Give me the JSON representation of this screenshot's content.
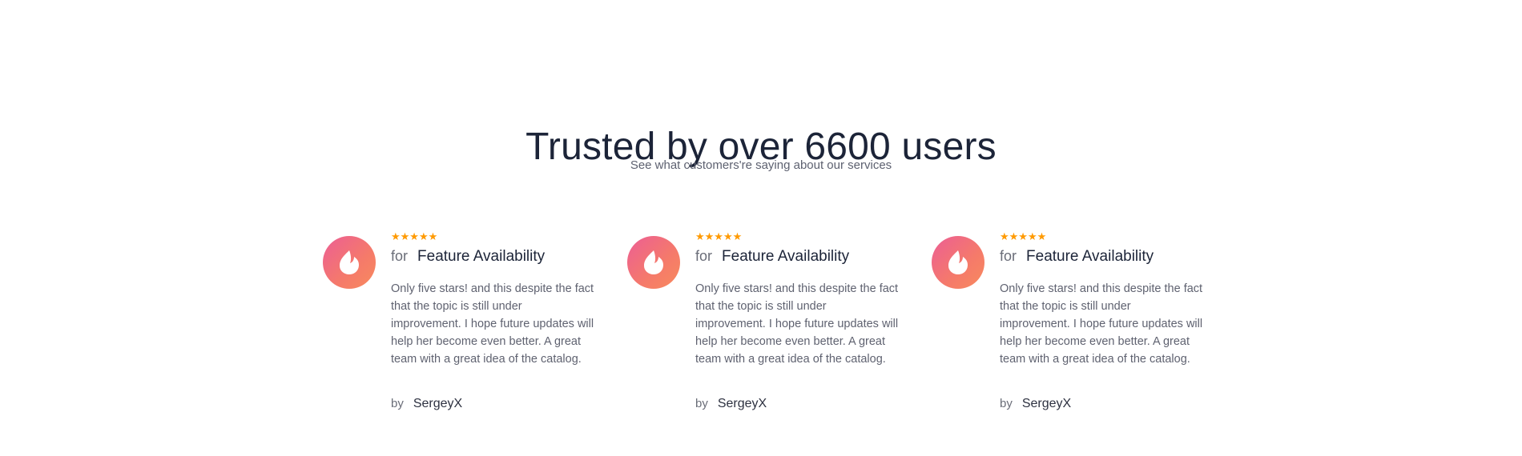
{
  "section": {
    "title": "Trusted by over 6600 users",
    "subtitle": "See what customers're saying about our services"
  },
  "colors": {
    "star": "#ff9a00",
    "avatar_gradient_start": "#ec5e95",
    "avatar_gradient_end": "#f88a5e",
    "heading": "#1c2438"
  },
  "reviews": [
    {
      "rating": 5,
      "stars": "★★★★★",
      "for_label": "for",
      "feature": "Feature Availability",
      "text": "Only five stars! and this despite the fact that the topic is still under improvement. I hope future updates will help her become even better. A great team with a great idea of the catalog.",
      "by_label": "by",
      "author": "SergeyX",
      "avatar_icon": "flame-logo-icon"
    },
    {
      "rating": 5,
      "stars": "★★★★★",
      "for_label": "for",
      "feature": "Feature Availability",
      "text": "Only five stars! and this despite the fact that the topic is still under improvement. I hope future updates will help her become even better. A great team with a great idea of the catalog.",
      "by_label": "by",
      "author": "SergeyX",
      "avatar_icon": "flame-logo-icon"
    },
    {
      "rating": 5,
      "stars": "★★★★★",
      "for_label": "for",
      "feature": "Feature Availability",
      "text": "Only five stars! and this despite the fact that the topic is still under improvement. I hope future updates will help her become even better. A great team with a great idea of the catalog.",
      "by_label": "by",
      "author": "SergeyX",
      "avatar_icon": "flame-logo-icon"
    }
  ]
}
